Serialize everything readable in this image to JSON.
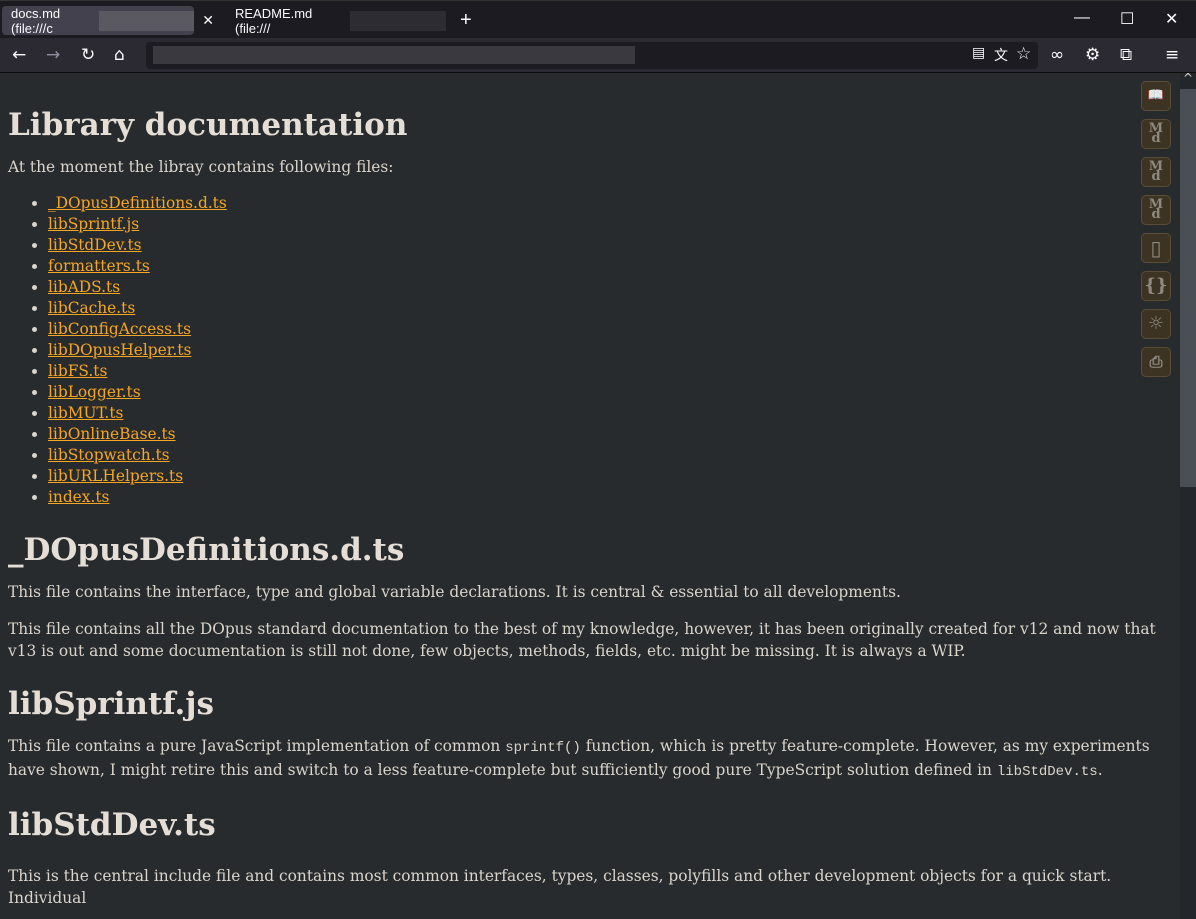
{
  "tabs": [
    {
      "label": "docs.md (file:///c",
      "active": true
    },
    {
      "label": "README.md (file:///",
      "active": false
    }
  ],
  "window": {
    "minimize": "—",
    "maximize": "☐",
    "close": "✕",
    "new_tab": "+"
  },
  "colors": {
    "background": "#282b2d",
    "text": "#d9d4cc",
    "link": "#f5a623",
    "sidebar_button": "#3d3323"
  },
  "sidebar_icons": [
    "book-icon",
    "markdown-icon",
    "markdown-icon",
    "markdown-icon",
    "layout-icon",
    "braces-icon",
    "sun-icon",
    "print-icon"
  ],
  "doc": {
    "title": "Library documentation",
    "intro": "At the moment the libray contains following files:",
    "files": [
      "_DOpusDefinitions.d.ts",
      "libSprintf.js",
      "libStdDev.ts",
      "formatters.ts",
      "libADS.ts",
      "libCache.ts",
      "libConfigAccess.ts",
      "libDOpusHelper.ts",
      "libFS.ts",
      "libLogger.ts",
      "libMUT.ts",
      "libOnlineBase.ts",
      "libStopwatch.ts",
      "libURLHelpers.ts",
      "index.ts"
    ],
    "s1": {
      "title": "_DOpusDefinitions.d.ts",
      "p1": "This file contains the interface, type and global variable declarations. It is central & essential to all developments.",
      "p2": "This file contains all the DOpus standard documentation to the best of my knowledge, however, it has been originally created for v12 and now that v13 is out and some documentation is still not done, few objects, methods, fields, etc. might be missing. It is always a WIP."
    },
    "s2": {
      "title": "libSprintf.js",
      "p_a": "This file contains a pure JavaScript implementation of common ",
      "code1": "sprintf()",
      "p_b": " function, which is pretty feature-complete. However, as my experiments have shown, I might retire this and switch to a less feature-complete but sufficiently good pure TypeScript solution defined in ",
      "code2": "libStdDev.ts",
      "p_c": "."
    },
    "s3": {
      "title": "libStdDev.ts",
      "p1": "This is the central include file and contains most common interfaces, types, classes, polyfills and other development objects for a quick start. Individual"
    }
  }
}
